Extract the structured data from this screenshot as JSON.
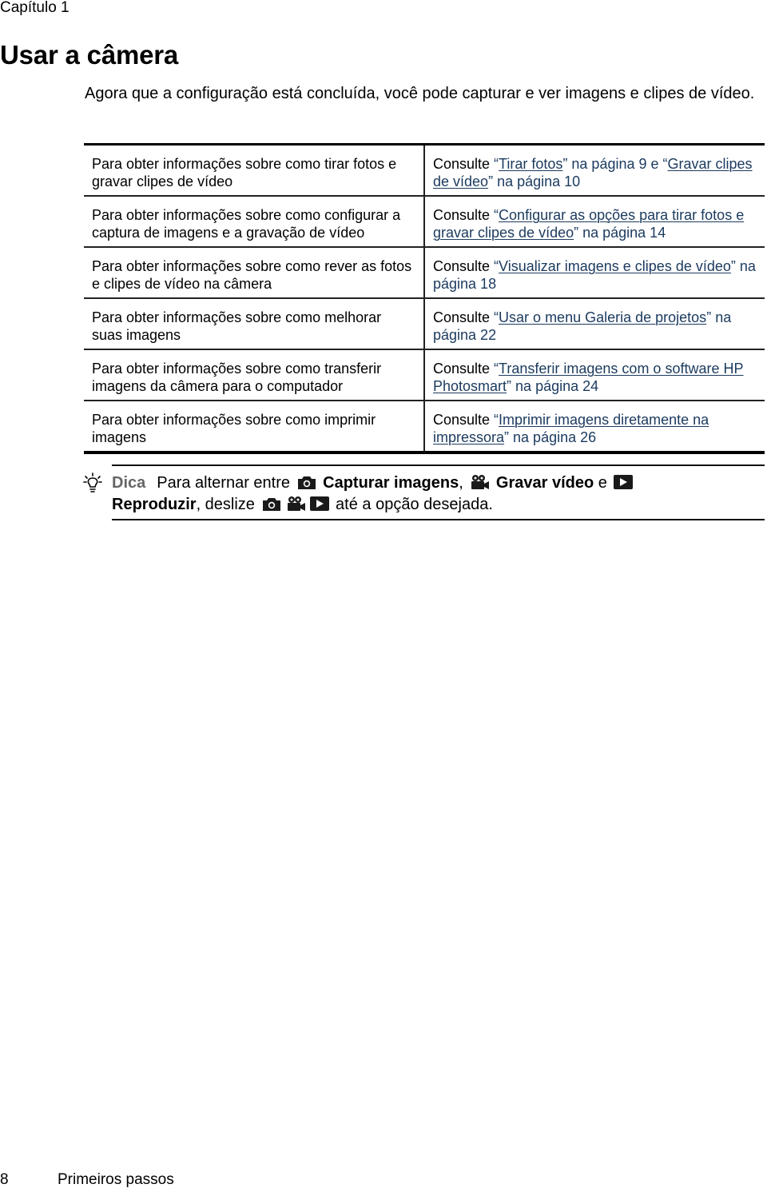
{
  "header": {
    "chapter": "Capítulo 1"
  },
  "page_title": "Usar a câmera",
  "intro": "Agora que a configuração está concluída, você pode capturar e ver imagens e clipes de vídeo.",
  "table": {
    "rows": [
      {
        "topic": "Para obter informações sobre como tirar fotos e gravar clipes de vídeo",
        "prefix": "Consulte ",
        "refs": [
          {
            "link": "Tirar fotos",
            "suffix": " na página 9 e "
          },
          {
            "link": "Gravar clipes de vídeo",
            "suffix": " na página 10"
          }
        ]
      },
      {
        "topic": "Para obter informações sobre como configurar a captura de imagens e a gravação de vídeo",
        "prefix": "Consulte ",
        "refs": [
          {
            "link": "Configurar as opções para tirar fotos e gravar clipes de vídeo",
            "suffix": " na página 14"
          }
        ]
      },
      {
        "topic": "Para obter informações sobre como rever as fotos e clipes de vídeo na câmera",
        "prefix": "Consulte ",
        "refs": [
          {
            "link": "Visualizar imagens e clipes de vídeo",
            "suffix": " na página 18"
          }
        ]
      },
      {
        "topic": "Para obter informações sobre como melhorar suas imagens",
        "prefix": "Consulte ",
        "refs": [
          {
            "link": "Usar o menu Galeria de projetos",
            "suffix": " na página 22"
          }
        ]
      },
      {
        "topic": "Para obter informações sobre como transferir imagens da câmera para o computador",
        "prefix": "Consulte ",
        "refs": [
          {
            "link": "Transferir imagens com o software HP Photosmart",
            "suffix": " na página 24"
          }
        ]
      },
      {
        "topic": "Para obter informações sobre como imprimir imagens",
        "prefix": "Consulte ",
        "refs": [
          {
            "link": "Imprimir imagens diretamente na impressora",
            "suffix": " na página 26"
          }
        ]
      }
    ]
  },
  "tip": {
    "icon": "lightbulb-icon",
    "label": "Dica",
    "text1": "Para alternar entre ",
    "capture_icon": "camera-icon",
    "capture_label": "Capturar imagens",
    "sep1": ", ",
    "video_icon": "video-camera-icon",
    "video_label": "Gravar vídeo",
    "sep2": " e ",
    "play_icon": "play-icon",
    "play_label": "Reproduzir",
    "text2": ", deslize ",
    "text3": " até a opção desejada."
  },
  "footer": {
    "page_number": "8",
    "section": "Primeiros passos"
  },
  "colors": {
    "link": "#1b3a5e",
    "dica": "#666666"
  }
}
